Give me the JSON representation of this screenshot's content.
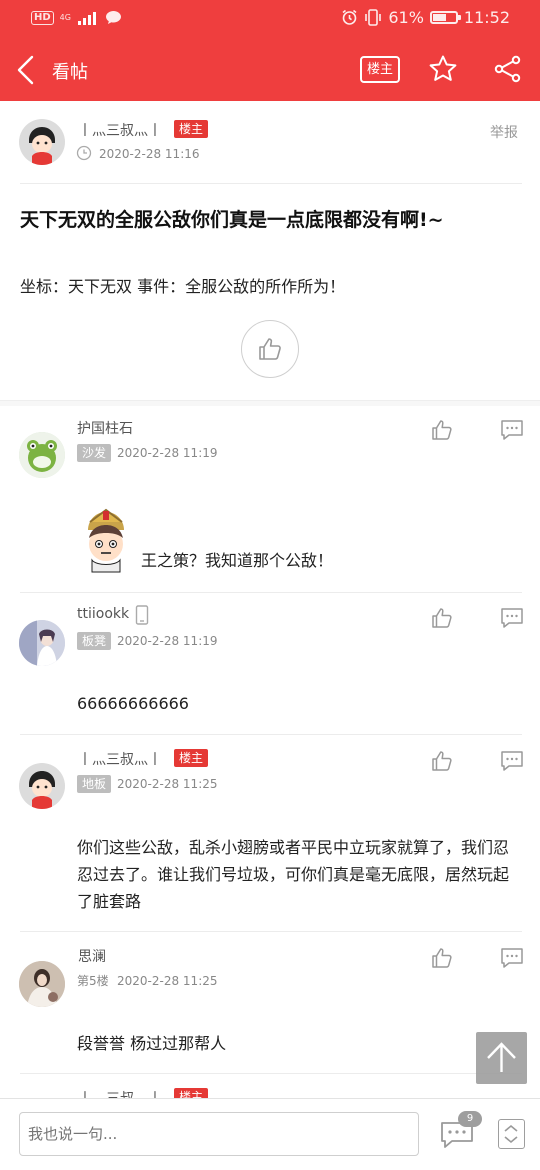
{
  "status_bar": {
    "battery": "61%",
    "time": "11:52",
    "hd": "HD",
    "network": "4G"
  },
  "header": {
    "title": "看帖",
    "owner_filter": "楼主"
  },
  "post": {
    "author": "丨灬三叔灬丨",
    "author_badge": "楼主",
    "time": "2020-2-28 11:16",
    "report": "举报",
    "title": "天下无双的全服公敌你们真是一点底限都没有啊!~",
    "body": "坐标：天下无双   事件：全服公敌的所作所为！"
  },
  "replies": [
    {
      "name": "护国柱石",
      "floor": "沙发",
      "time": "2020-2-28 11:19",
      "text": "王之策？我知道那个公敌！"
    },
    {
      "name": "ttiiookk",
      "floor": "板凳",
      "time": "2020-2-28 11:19",
      "text": "66666666666"
    },
    {
      "name": "丨灬三叔灬丨",
      "badge": "楼主",
      "floor": "地板",
      "time": "2020-2-28 11:25",
      "text": "你们这些公敌，乱杀小翅膀或者平民中立玩家就算了，我们忍忍过去了。谁让我们号垃圾，可你们真是毫无底限，居然玩起了脏套路"
    },
    {
      "name": "思澜",
      "floor": "第5楼",
      "time": "2020-2-28 11:25",
      "text": "段誉誉 杨过过那帮人"
    },
    {
      "name": "丨灬三叔灬丨",
      "badge": "楼主"
    }
  ],
  "bottom_bar": {
    "placeholder": "我也说一句...",
    "comment_count": "9"
  },
  "colors": {
    "brand_red": "#ef3e3e",
    "badge_red": "#e53935",
    "badge_gray": "#bdbdbd"
  }
}
